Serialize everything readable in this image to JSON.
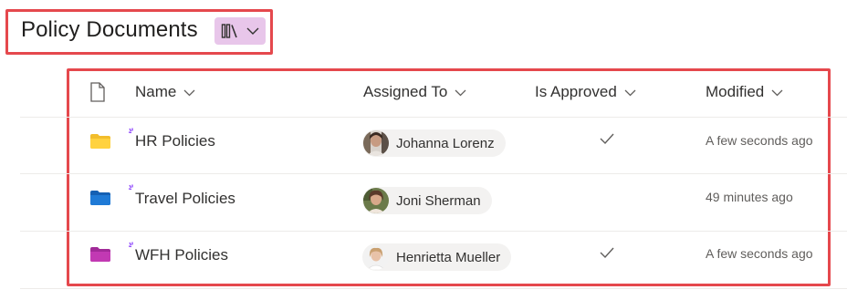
{
  "library": {
    "title": "Policy Documents"
  },
  "columns": {
    "name": "Name",
    "assigned_to": "Assigned To",
    "is_approved": "Is Approved",
    "modified": "Modified"
  },
  "rows": [
    {
      "name": "HR Policies",
      "folder_color": "#ffd23f",
      "assigned_to": "Johanna Lorenz",
      "approved": true,
      "modified": "A few seconds ago"
    },
    {
      "name": "Travel Policies",
      "folder_color": "#1f7ad6",
      "assigned_to": "Joni Sherman",
      "approved": false,
      "modified": "49 minutes ago"
    },
    {
      "name": "WFH Policies",
      "folder_color": "#c239b3",
      "assigned_to": "Henrietta Mueller",
      "approved": true,
      "modified": "A few seconds ago"
    }
  ],
  "colors": {
    "highlight_border": "#e5484d",
    "view_button_bg": "#e8c6ea",
    "new_badge": "#8a3ffc",
    "check": "#605e5c"
  },
  "icons": {
    "view": "library-view-icon",
    "chevron": "chevron-down-icon",
    "file_type": "document-icon",
    "folder": "folder-icon",
    "new_item": "new-item-sparkle-icon",
    "approved": "checkmark-icon"
  }
}
